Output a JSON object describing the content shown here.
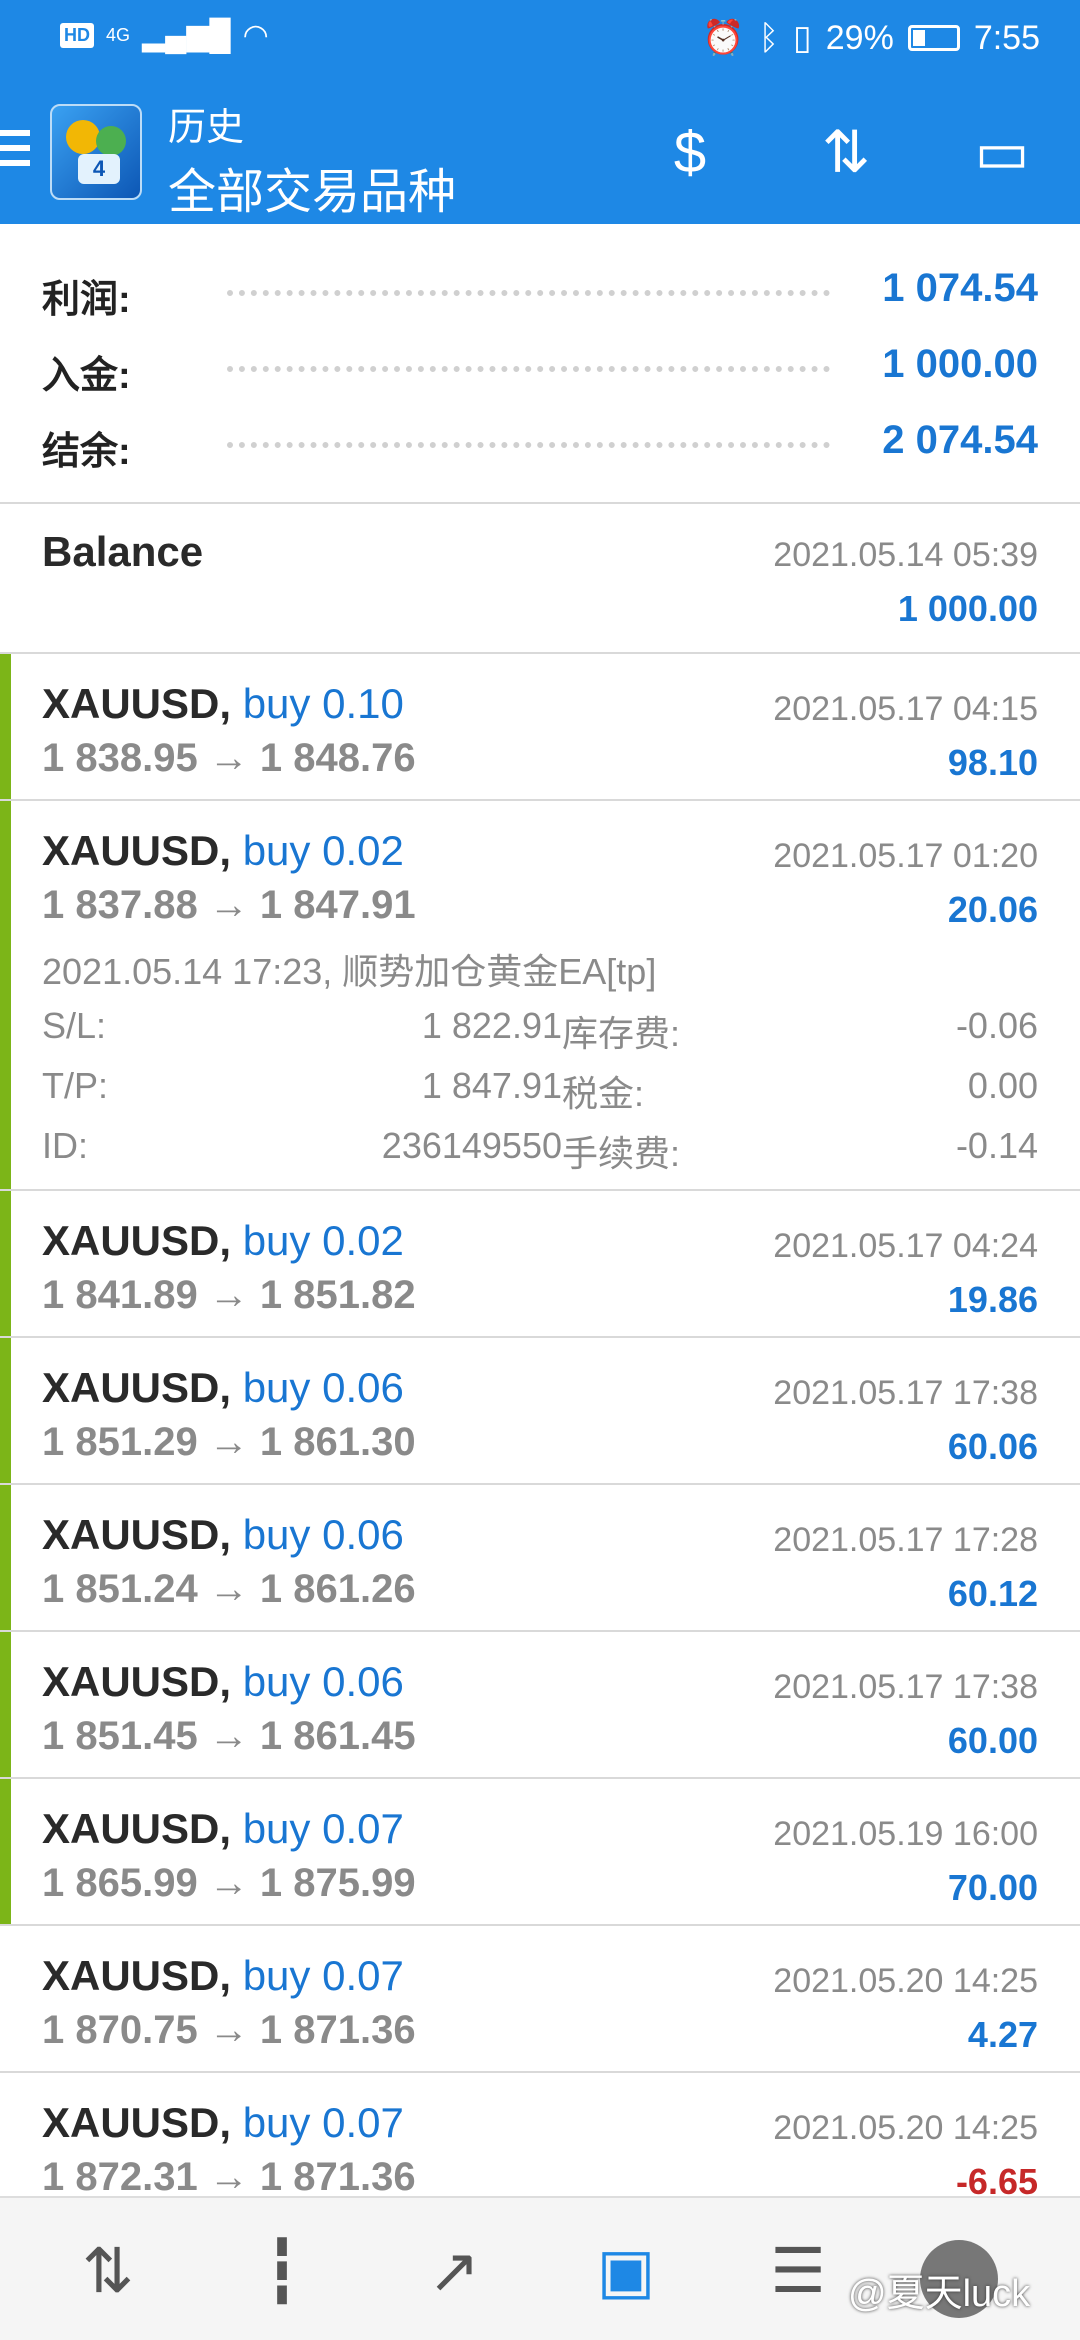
{
  "status_bar": {
    "hd": "HD",
    "network": "4G",
    "battery_pct": "29%",
    "time": "7:55"
  },
  "app_bar": {
    "title": "历史",
    "subtitle": "全部交易品种"
  },
  "summary": [
    {
      "label": "利润:",
      "value": "1 074.54"
    },
    {
      "label": "入金:",
      "value": "1 000.00"
    },
    {
      "label": "结余:",
      "value": "2 074.54"
    }
  ],
  "balance": {
    "label": "Balance",
    "date": "2021.05.14 05:39",
    "value": "1 000.00"
  },
  "trades": [
    {
      "symbol": "XAUUSD,",
      "direction": "buy 0.10",
      "prices": "1 838.95 → 1 848.76",
      "date": "2021.05.17 04:15",
      "profit": "98.10",
      "negative": false,
      "bar": true
    },
    {
      "symbol": "XAUUSD,",
      "direction": "buy 0.02",
      "prices": "1 837.88 → 1 847.91",
      "date": "2021.05.17 01:20",
      "profit": "20.06",
      "negative": false,
      "bar": true,
      "expanded": {
        "note": "2021.05.14 17:23, 顺势加仓黄金EA[tp]",
        "rows": [
          {
            "k1": "S/L:",
            "v1": "1 822.91",
            "k2": "库存费:",
            "v2": "-0.06"
          },
          {
            "k1": "T/P:",
            "v1": "1 847.91",
            "k2": "税金:",
            "v2": "0.00"
          },
          {
            "k1": "ID:",
            "v1": "236149550",
            "k2": "手续费:",
            "v2": "-0.14"
          }
        ]
      }
    },
    {
      "symbol": "XAUUSD,",
      "direction": "buy 0.02",
      "prices": "1 841.89 → 1 851.82",
      "date": "2021.05.17 04:24",
      "profit": "19.86",
      "negative": false,
      "bar": true
    },
    {
      "symbol": "XAUUSD,",
      "direction": "buy 0.06",
      "prices": "1 851.29 → 1 861.30",
      "date": "2021.05.17 17:38",
      "profit": "60.06",
      "negative": false,
      "bar": true
    },
    {
      "symbol": "XAUUSD,",
      "direction": "buy 0.06",
      "prices": "1 851.24 → 1 861.26",
      "date": "2021.05.17 17:28",
      "profit": "60.12",
      "negative": false,
      "bar": true
    },
    {
      "symbol": "XAUUSD,",
      "direction": "buy 0.06",
      "prices": "1 851.45 → 1 861.45",
      "date": "2021.05.17 17:38",
      "profit": "60.00",
      "negative": false,
      "bar": true
    },
    {
      "symbol": "XAUUSD,",
      "direction": "buy 0.07",
      "prices": "1 865.99 → 1 875.99",
      "date": "2021.05.19 16:00",
      "profit": "70.00",
      "negative": false,
      "bar": true
    },
    {
      "symbol": "XAUUSD,",
      "direction": "buy 0.07",
      "prices": "1 870.75 → 1 871.36",
      "date": "2021.05.20 14:25",
      "profit": "4.27",
      "negative": false,
      "bar": false
    },
    {
      "symbol": "XAUUSD,",
      "direction": "buy 0.07",
      "prices": "1 872.31 → 1 871.36",
      "date": "2021.05.20 14:25",
      "profit": "-6.65",
      "negative": true,
      "bar": false
    }
  ],
  "bottom_nav": {
    "icons": [
      "quotes-icon",
      "chart-icon",
      "trade-icon",
      "history-icon",
      "news-icon"
    ],
    "active": "history-icon"
  },
  "watermark": "@夏天luck",
  "colors": {
    "accent": "#1e88e5",
    "profit_positive": "#1976d2",
    "profit_negative": "#c62828",
    "win_bar": "#7cb518"
  }
}
